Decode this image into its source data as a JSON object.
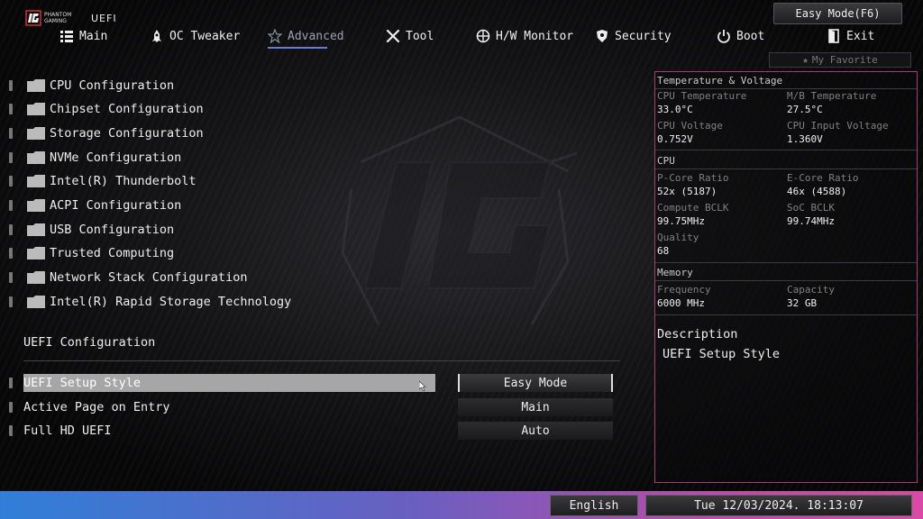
{
  "header": {
    "brand_line1": "PHANTOM",
    "brand_line2": "GAMING",
    "uefi_label": "UEFI",
    "easy_mode_label": "Easy Mode(F6)",
    "favorite_label": "My Favorite"
  },
  "nav": {
    "items": [
      {
        "label": "Main",
        "icon": "list-icon"
      },
      {
        "label": "OC Tweaker",
        "icon": "rocket-icon"
      },
      {
        "label": "Advanced",
        "icon": "star-icon",
        "active": true
      },
      {
        "label": "Tool",
        "icon": "tools-icon"
      },
      {
        "label": "H/W Monitor",
        "icon": "monitor-icon"
      },
      {
        "label": "Security",
        "icon": "shield-icon"
      },
      {
        "label": "Boot",
        "icon": "power-icon"
      },
      {
        "label": "Exit",
        "icon": "exit-icon"
      }
    ]
  },
  "menu": {
    "items": [
      "CPU Configuration",
      "Chipset Configuration",
      "Storage Configuration",
      "NVMe Configuration",
      "Intel(R) Thunderbolt",
      "ACPI Configuration",
      "USB Configuration",
      "Trusted Computing",
      "Network Stack Configuration",
      "Intel(R) Rapid Storage Technology"
    ]
  },
  "uefi_config": {
    "title": "UEFI Configuration",
    "options": [
      {
        "label": "UEFI Setup Style",
        "value": "Easy Mode",
        "selected": true
      },
      {
        "label": "Active Page on Entry",
        "value": "Main"
      },
      {
        "label": "Full HD UEFI",
        "value": "Auto"
      }
    ]
  },
  "panel": {
    "temp_title": "Temperature & Voltage",
    "cpu_temp_label": "CPU Temperature",
    "cpu_temp": "33.0°C",
    "mb_temp_label": "M/B Temperature",
    "mb_temp": "27.5°C",
    "cpu_volt_label": "CPU Voltage",
    "cpu_volt": "0.752V",
    "cpu_in_volt_label": "CPU Input Voltage",
    "cpu_in_volt": "1.360V",
    "cpu_title": "CPU",
    "pcore_label": "P-Core Ratio",
    "pcore": "52x (5187)",
    "ecore_label": "E-Core Ratio",
    "ecore": "46x (4588)",
    "bclk_label": "Compute BCLK",
    "bclk": "99.75MHz",
    "soc_label": "SoC BCLK",
    "soc": "99.74MHz",
    "quality_label": "Quality",
    "quality": "68",
    "mem_title": "Memory",
    "freq_label": "Frequency",
    "freq": "6000 MHz",
    "cap_label": "Capacity",
    "cap": "32 GB",
    "desc_title": "Description",
    "desc_text": "UEFI Setup Style"
  },
  "footer": {
    "language": "English",
    "datetime": "Tue 12/03/2024. 18:13:07"
  },
  "colors": {
    "accent_underline": "#6a7ad8",
    "panel_border": "#a0407a",
    "bar_start": "#2f7fd8",
    "bar_end": "#d84aa6"
  }
}
